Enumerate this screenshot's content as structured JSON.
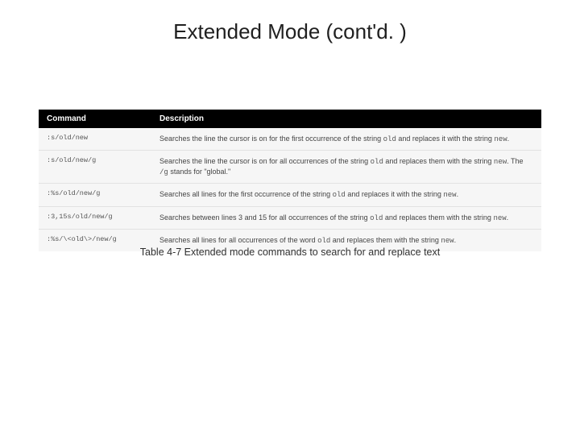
{
  "title": "Extended Mode (cont'd. )",
  "table": {
    "headers": {
      "command": "Command",
      "description": "Description"
    },
    "rows": [
      {
        "command": ":s/old/new",
        "desc_t0": "Searches the line the cursor is on for the first occurrence of the string ",
        "desc_m0": "old",
        "desc_t1": " and replaces it with the string ",
        "desc_m1": "new",
        "desc_t2": "."
      },
      {
        "command": ":s/old/new/g",
        "desc_t0": "Searches the line the cursor is on for all occurrences of the string ",
        "desc_m0": "old",
        "desc_t1": " and replaces them with the string ",
        "desc_m1": "new",
        "desc_t2": ". The ",
        "desc_m2": "/g",
        "desc_t3": " stands for \"global.\""
      },
      {
        "command": ":%s/old/new/g",
        "desc_t0": "Searches all lines for the first occurrence of the string ",
        "desc_m0": "old",
        "desc_t1": " and replaces it with the string ",
        "desc_m1": "new",
        "desc_t2": "."
      },
      {
        "command": ":3,15s/old/new/g",
        "desc_t0": "Searches between lines 3 and 15 for all occurrences of the string ",
        "desc_m0": "old",
        "desc_t1": " and replaces them with the string ",
        "desc_m1": "new",
        "desc_t2": "."
      },
      {
        "command": ":%s/\\<old\\>/new/g",
        "desc_t0": "Searches all lines for all occurrences of the word ",
        "desc_m0": "old",
        "desc_t1": " and replaces them with the string ",
        "desc_m1": "new",
        "desc_t2": "."
      }
    ]
  },
  "caption": "Table 4-7 Extended mode commands to search for and replace text"
}
